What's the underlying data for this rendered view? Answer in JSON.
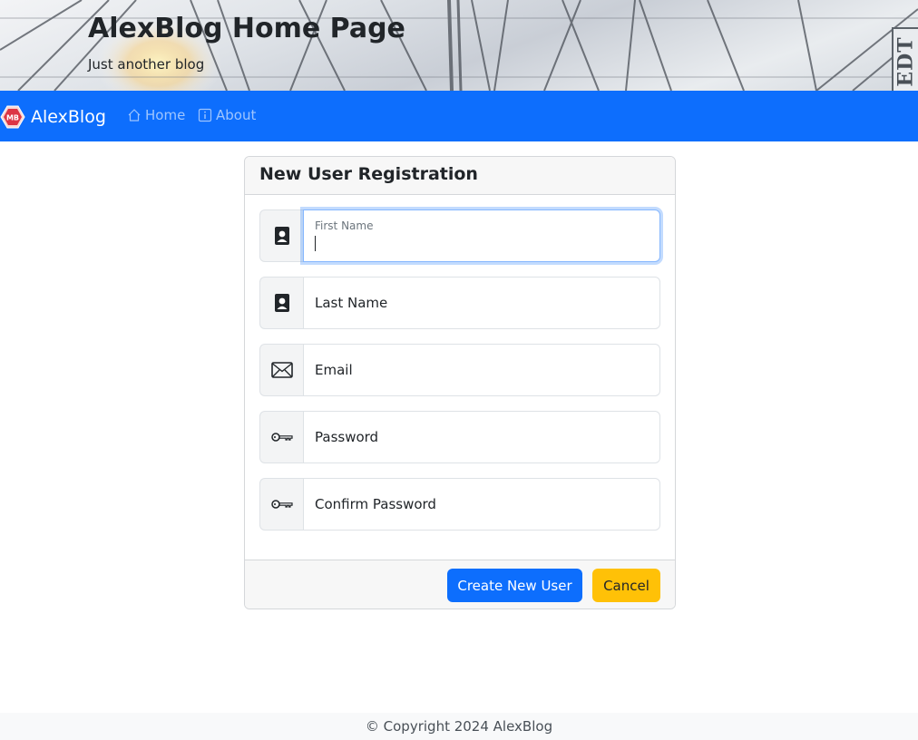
{
  "header": {
    "title": "AlexBlog Home Page",
    "subtitle": "Just another blog",
    "badge_text": "EDT"
  },
  "navbar": {
    "brand_logo_text": "MB",
    "brand": "AlexBlog",
    "links": [
      {
        "label": "Home",
        "icon": "house-icon"
      },
      {
        "label": "About",
        "icon": "info-square-icon"
      }
    ]
  },
  "form": {
    "title": "New User Registration",
    "fields": [
      {
        "label": "First Name",
        "icon": "person-badge-icon",
        "value": "",
        "focused": true
      },
      {
        "label": "Last Name",
        "icon": "person-badge-icon",
        "value": ""
      },
      {
        "label": "Email",
        "icon": "envelope-icon",
        "value": ""
      },
      {
        "label": "Password",
        "icon": "key-icon",
        "value": ""
      },
      {
        "label": "Confirm Password",
        "icon": "key-icon",
        "value": ""
      }
    ],
    "submit_label": "Create New User",
    "cancel_label": "Cancel"
  },
  "footer": {
    "copyright": "© Copyright 2024 AlexBlog"
  },
  "colors": {
    "primary": "#0d6efd",
    "warning": "#ffc107",
    "focus_ring": "#86b7fe"
  }
}
